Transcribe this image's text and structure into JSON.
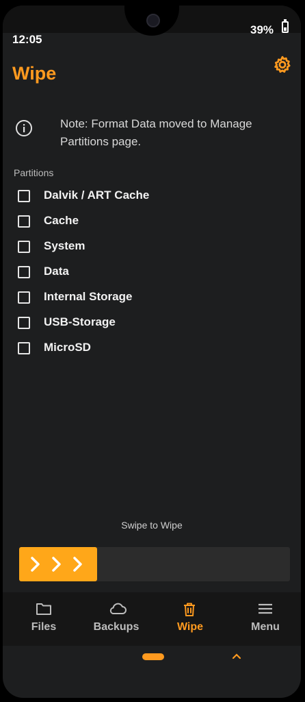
{
  "status_bar": {
    "time": "12:05",
    "battery": "39%"
  },
  "header": {
    "title": "Wipe"
  },
  "note": {
    "text": "Note: Format Data moved to Manage Partitions page."
  },
  "partitions": {
    "label": "Partitions",
    "items": [
      {
        "label": "Dalvik / ART Cache",
        "checked": false
      },
      {
        "label": "Cache",
        "checked": false
      },
      {
        "label": "System",
        "checked": false
      },
      {
        "label": "Data",
        "checked": false
      },
      {
        "label": "Internal Storage",
        "checked": false
      },
      {
        "label": "USB-Storage",
        "checked": false
      },
      {
        "label": "MicroSD",
        "checked": false
      }
    ]
  },
  "swipe": {
    "label": "Swipe to Wipe",
    "progress": 0
  },
  "bottom_nav": {
    "items": [
      {
        "label": "Files",
        "icon": "folder-icon",
        "active": false
      },
      {
        "label": "Backups",
        "icon": "cloud-icon",
        "active": false
      },
      {
        "label": "Wipe",
        "icon": "trash-icon",
        "active": true
      },
      {
        "label": "Menu",
        "icon": "menu-icon",
        "active": false
      }
    ]
  },
  "colors": {
    "accent": "#ff9a1f",
    "background": "#1d1e1f",
    "text": "#f2f2f2"
  }
}
